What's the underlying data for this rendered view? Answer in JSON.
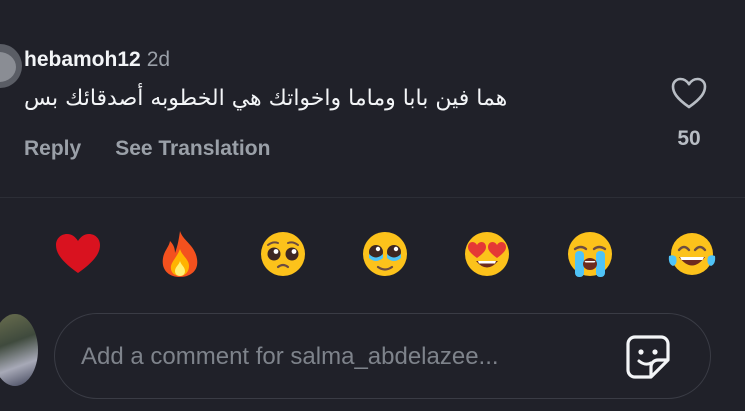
{
  "comment": {
    "username": "hebamoh12",
    "time": "2d",
    "text": "هما فين بابا وماما واخواتك هي الخطوبه أصدقائك بس",
    "reply_label": "Reply",
    "translate_label": "See Translation",
    "like_count": "50"
  },
  "reactions": [
    {
      "emoji": "❤️",
      "name": "red-heart"
    },
    {
      "emoji": "🔥",
      "name": "fire"
    },
    {
      "emoji": "🥺",
      "name": "pleading-face"
    },
    {
      "emoji": "🥹",
      "name": "holding-back-tears"
    },
    {
      "emoji": "😍",
      "name": "heart-eyes"
    },
    {
      "emoji": "😭",
      "name": "loudly-crying"
    },
    {
      "emoji": "😂",
      "name": "tears-of-joy"
    }
  ],
  "composer": {
    "placeholder": "Add a comment for salma_abdelazee..."
  },
  "colors": {
    "background": "#202129",
    "primary_text": "#f3f5f7",
    "secondary_text": "#9aa0a8"
  }
}
